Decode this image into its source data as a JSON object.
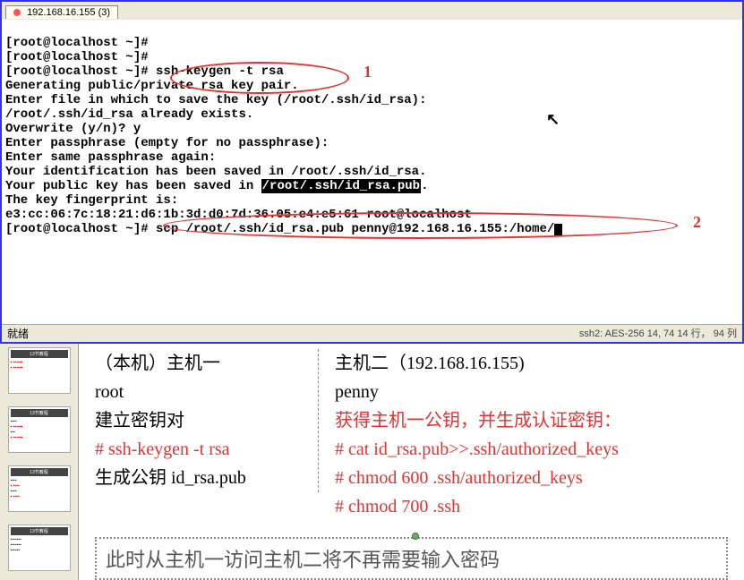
{
  "tab": {
    "ip": "192.168.16.155",
    "count": "(3)"
  },
  "term": {
    "l1": "[root@localhost ~]#",
    "l2": "[root@localhost ~]#",
    "l3": "[root@localhost ~]# ssh-keygen -t rsa",
    "l4": "Generating public/private rsa key pair.",
    "l5": "Enter file in which to save the key (/root/.ssh/id_rsa):",
    "l6": "/root/.ssh/id_rsa already exists.",
    "l7": "Overwrite (y/n)? y",
    "l8": "Enter passphrase (empty for no passphrase):",
    "l9": "Enter same passphrase again:",
    "l10": "Your identification has been saved in /root/.ssh/id_rsa.",
    "l11a": "Your public key has been saved in ",
    "l11b": "/root/.ssh/id_rsa.pub",
    "l11c": ".",
    "l12": "The key fingerprint is:",
    "l13": "e3:cc:06:7c:18:21:d6:1b:3d:d0:7d:36:05:e4:e5:61 root@localhost",
    "l14": "[root@localhost ~]# scp /root/.ssh/id_rsa.pub penny@192.168.16.155:/home/"
  },
  "annotations": {
    "a1": "1",
    "a2": "2"
  },
  "status": {
    "left": "就绪",
    "right": "ssh2: AES-256  14,  74   14 行， 94 列"
  },
  "mouse": "⮰",
  "doc": {
    "c1": {
      "title": "（本机）主机一",
      "user": "root",
      "step1": "建立密钥对",
      "cmd1": "# ssh-keygen -t rsa",
      "step2_a": "生成公钥 ",
      "step2_b": "id_rsa.pub"
    },
    "c2": {
      "title": "主机二（192.168.16.155)",
      "user": "penny",
      "step1": "获得主机一公钥，并生成认证密钥：",
      "cmd1": "# cat id_rsa.pub>>.ssh/authorized_keys",
      "cmd2": "# chmod 600 .ssh/authorized_keys",
      "cmd3": "# chmod 700 .ssh"
    },
    "footer": "此时从主机一访问主机二将不再需要输入密码"
  },
  "thumbs": {
    "t_title": "13节教程"
  }
}
